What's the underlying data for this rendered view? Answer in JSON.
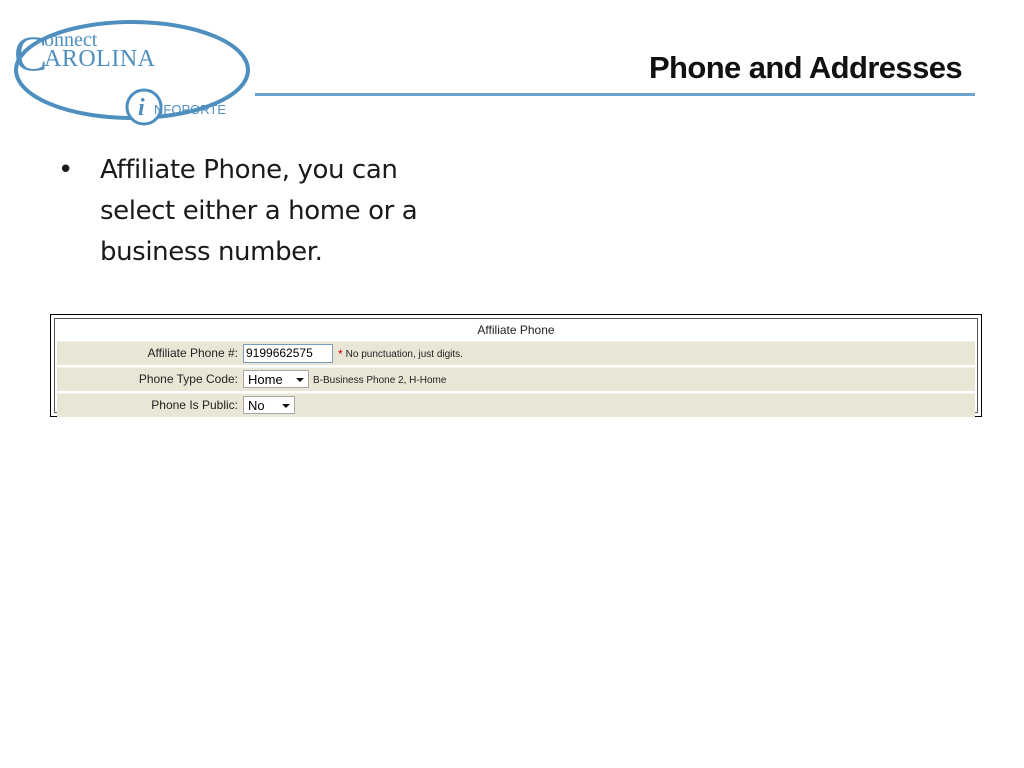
{
  "logo": {
    "line1": "onnect",
    "line2": "AROLINA",
    "big_c": "C",
    "sub_i": "i",
    "sub_text": "NFOPORTE",
    "brand_color": "#4f8fc0"
  },
  "slide": {
    "title": "Phone and Addresses",
    "rule_color": "#6fa3cf"
  },
  "bullets": [
    {
      "marker": "•",
      "text": "Affiliate Phone, you can select either a home or a business number."
    }
  ],
  "form": {
    "caption": "Affiliate Phone",
    "row_bg": "#e9e6d6",
    "rows": {
      "phone": {
        "label": "Affiliate Phone #:",
        "value": "9199662575",
        "required_mark": "*",
        "note": "No punctuation, just digits."
      },
      "type": {
        "label": "Phone Type Code:",
        "selected": "Home",
        "hint": "B-Business Phone 2, H-Home"
      },
      "public": {
        "label": "Phone Is Public:",
        "selected": "No"
      }
    }
  }
}
